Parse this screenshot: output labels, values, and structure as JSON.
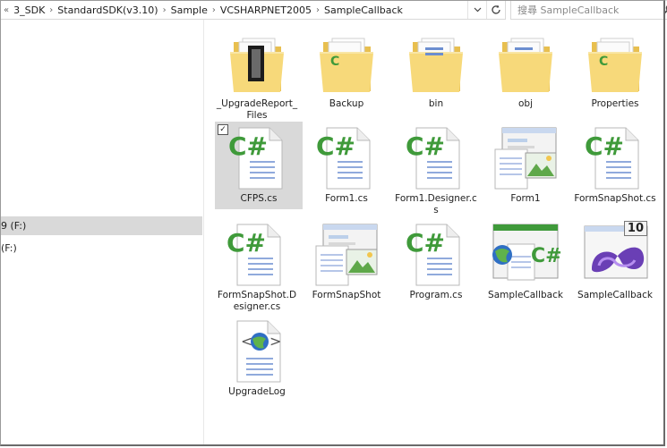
{
  "address_bar": {
    "crumbs": [
      "3_SDK",
      "StandardSDK(v3.10)",
      "Sample",
      "VCSHARPNET2005",
      "SampleCallback"
    ],
    "lead_glyph": "«"
  },
  "search": {
    "placeholder": "搜尋 SampleCallback"
  },
  "nav": {
    "drives": [
      {
        "label": "9 (F:)",
        "selected": true
      },
      {
        "label": "(F:)",
        "selected": false
      }
    ]
  },
  "items": [
    {
      "label": "_UpgradeReport_Files",
      "icon": "folder-report-icon",
      "selected": false
    },
    {
      "label": "Backup",
      "icon": "folder-icon",
      "selected": false
    },
    {
      "label": "bin",
      "icon": "folder-icon",
      "selected": false
    },
    {
      "label": "obj",
      "icon": "folder-icon",
      "selected": false
    },
    {
      "label": "Properties",
      "icon": "folder-icon",
      "selected": false
    },
    {
      "label": "CFPS.cs",
      "icon": "csharp-file-icon",
      "selected": true
    },
    {
      "label": "Form1.cs",
      "icon": "csharp-file-icon",
      "selected": false
    },
    {
      "label": "Form1.Designer.cs",
      "icon": "csharp-file-icon",
      "selected": false
    },
    {
      "label": "Form1",
      "icon": "resx-file-icon",
      "selected": false
    },
    {
      "label": "FormSnapShot.cs",
      "icon": "csharp-file-icon",
      "selected": false
    },
    {
      "label": "FormSnapShot.Designer.cs",
      "icon": "csharp-file-icon",
      "selected": false
    },
    {
      "label": "FormSnapShot",
      "icon": "resx-file-icon",
      "selected": false
    },
    {
      "label": "Program.cs",
      "icon": "csharp-file-icon",
      "selected": false
    },
    {
      "label": "SampleCallback",
      "icon": "csproj-file-icon",
      "selected": false
    },
    {
      "label": "SampleCallback",
      "icon": "visual-studio-solution-icon",
      "selected": false
    },
    {
      "label": "UpgradeLog",
      "icon": "upgrade-log-icon",
      "selected": false
    }
  ],
  "vs_badge": "10",
  "colors": {
    "folder": "#f5d77a",
    "csharp": "#3f9a3a",
    "selection": "#d9d9d9"
  }
}
